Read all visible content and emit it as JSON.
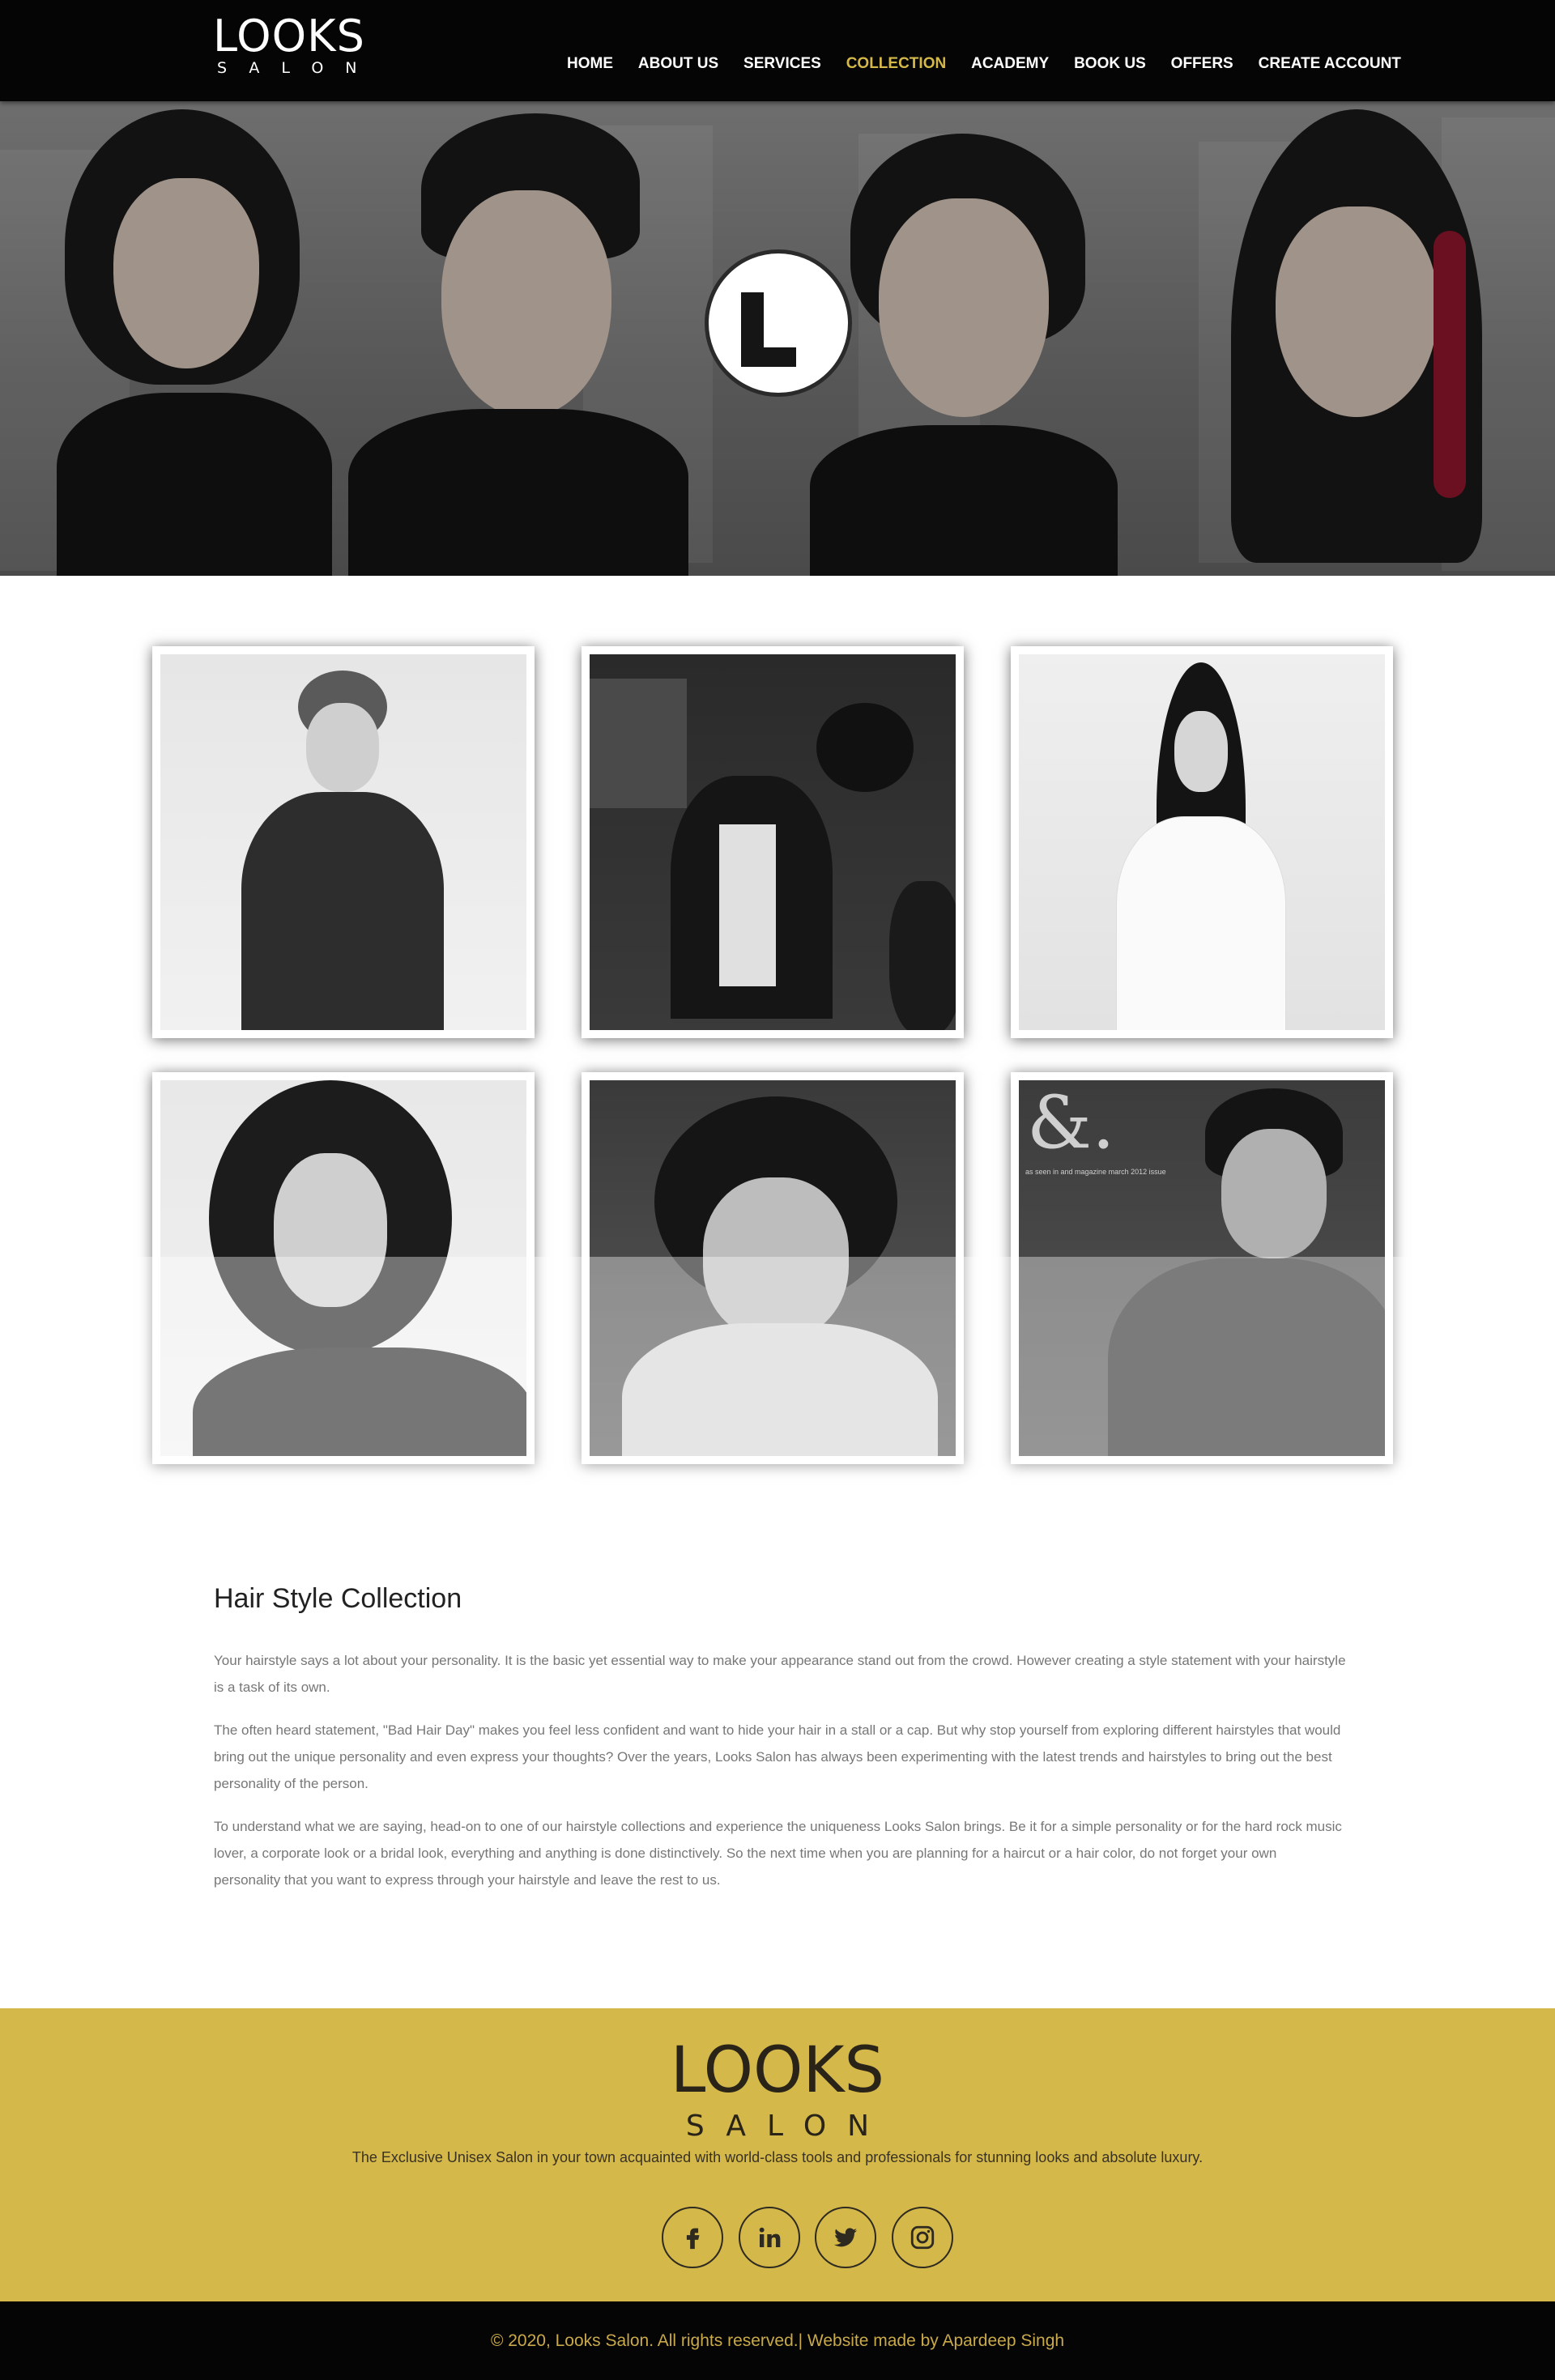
{
  "header": {
    "logo_main": "LOOKS",
    "logo_sub": "SALON",
    "nav": [
      {
        "label": "HOME",
        "active": false
      },
      {
        "label": "ABOUT US",
        "active": false
      },
      {
        "label": "SERVICES",
        "active": false
      },
      {
        "label": "COLLECTION",
        "active": true
      },
      {
        "label": "ACADEMY",
        "active": false
      },
      {
        "label": "BOOK US",
        "active": false
      },
      {
        "label": "OFFERS",
        "active": false
      },
      {
        "label": "CREATE ACCOUNT",
        "active": false
      }
    ]
  },
  "hero": {
    "emblem_letter": "L"
  },
  "gallery": {
    "photo6_caption": "as seen in and magazine march 2012 issue"
  },
  "content": {
    "title": "Hair Style Collection",
    "paragraphs": [
      "Your hairstyle says a lot about your personality. It is the basic yet essential way to make your appearance stand out from the crowd. However creating a style statement with your hairstyle is a task of its own.",
      "The often heard statement, \"Bad Hair Day\" makes you feel less confident and want to hide your hair in a stall or a cap. But why stop yourself from exploring different hairstyles that would bring out the unique personality and even express your thoughts? Over the years, Looks Salon has always been experimenting with the latest trends and hairstyles to bring out the best personality of the person.",
      "To understand what we are saying, head-on to one of our hairstyle collections and experience the uniqueness Looks Salon brings. Be it for a simple personality or for the hard rock music lover, a corporate look or a bridal look, everything and anything is done distinctively. So the next time when you are planning for a haircut or a hair color, do not forget your own personality that you want to express through your hairstyle and leave the rest to us."
    ]
  },
  "footer": {
    "logo_main": "LOOKS",
    "logo_sub": "SALON",
    "tagline": "The Exclusive Unisex Salon in your town acquainted with world-class tools and professionals for stunning looks and absolute luxury.",
    "socials": [
      "facebook-icon",
      "linkedin-icon",
      "twitter-icon",
      "instagram-icon"
    ],
    "copyright": "© 2020, Looks Salon. All rights reserved.| Website made by Apardeep Singh"
  },
  "colors": {
    "accent": "#d4b84a",
    "dark": "#050505"
  }
}
